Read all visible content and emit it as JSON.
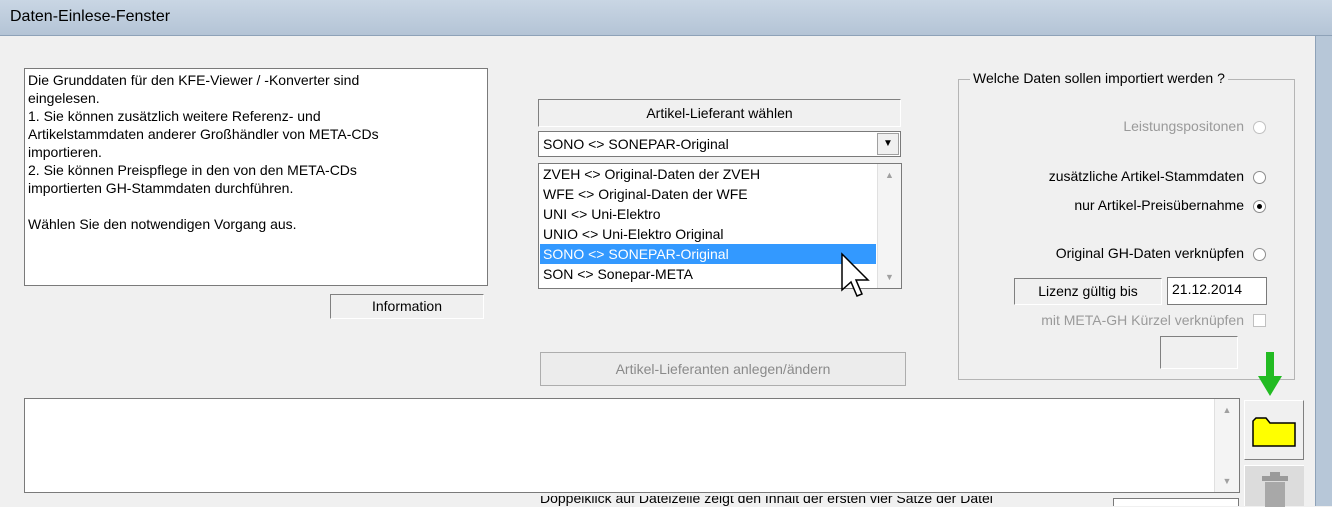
{
  "window": {
    "title": "Daten-Einlese-Fenster"
  },
  "info": {
    "text": "Die Grunddaten für den KFE-Viewer / -Konverter sind\neingelesen.\n1. Sie können zusätzlich weitere Referenz- und\nArtikelstammdaten anderer Großhändler von META-CDs\nimportieren.\n2. Sie können Preispflege in den von den META-CDs\nimportierten GH-Stammdaten durchführen.\n\nWählen Sie den notwendigen Vorgang aus.",
    "label": "Information"
  },
  "supplier": {
    "header": "Artikel-Lieferant wählen",
    "selected": "SONO <> SONEPAR-Original",
    "options": [
      "ZVEH <> Original-Daten der ZVEH",
      "WFE <> Original-Daten der WFE",
      "UNI <> Uni-Elektro",
      "UNIO <> Uni-Elektro Original",
      "SONO <> SONEPAR-Original",
      "SON <> Sonepar-META"
    ],
    "highlighted_index": 4,
    "manage_button": "Artikel-Lieferanten anlegen/ändern"
  },
  "import": {
    "group_title": "Welche Daten sollen importiert werden ?",
    "options": [
      {
        "label": "Leistungspositonen",
        "checked": false,
        "enabled": false
      },
      {
        "label": "zusätzliche Artikel-Stammdaten",
        "checked": false,
        "enabled": true
      },
      {
        "label": "nur Artikel-Preisübernahme",
        "checked": true,
        "enabled": true
      },
      {
        "label": "Original GH-Daten verknüpfen",
        "checked": false,
        "enabled": true
      }
    ],
    "license_label": "Lizenz gültig bis",
    "license_date": "21.12.2014",
    "meta_link_label": "mit META-GH Kürzel verknüpfen",
    "meta_code": ""
  },
  "file": {
    "content": "",
    "hint": "Doppelklick auf Dateizeile zeigt den Inhalt der ersten vier Sätze der Datei"
  },
  "colors": {
    "selection": "#3399ff",
    "folder": "#ffff00",
    "arrow": "#22bb22"
  }
}
